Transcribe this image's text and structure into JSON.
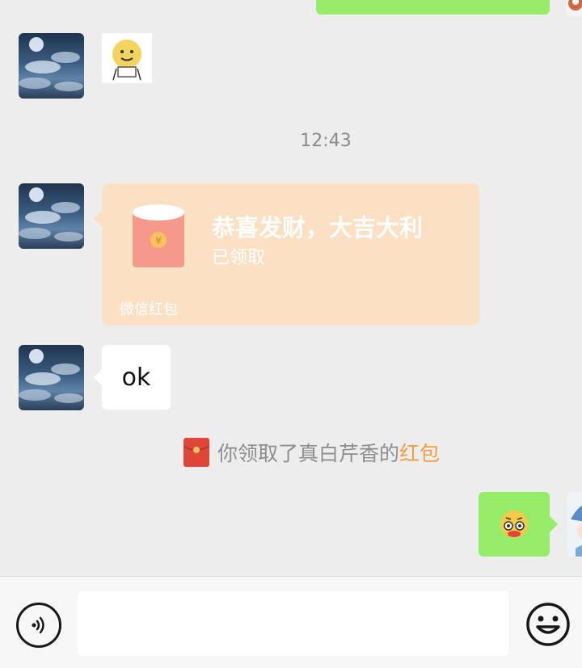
{
  "chat": {
    "timestamp": "12:43",
    "red_packet": {
      "greeting": "恭喜发财，大吉大利",
      "status": "已领取",
      "source": "微信红包"
    },
    "ok_message": "ok",
    "system_message": {
      "text": "你领取了真白芹香的",
      "link": "红包"
    }
  },
  "input": {
    "placeholder": ""
  },
  "colors": {
    "background": "#ededed",
    "my_bubble": "#95ec69",
    "red_packet_card": "#fbe0c3",
    "red_packet_link": "#f39d45",
    "input_bar": "#f7f7f7"
  },
  "icons": {
    "voice": "voice-icon",
    "emoji": "emoji-icon",
    "red_packet": "red-envelope-icon"
  }
}
